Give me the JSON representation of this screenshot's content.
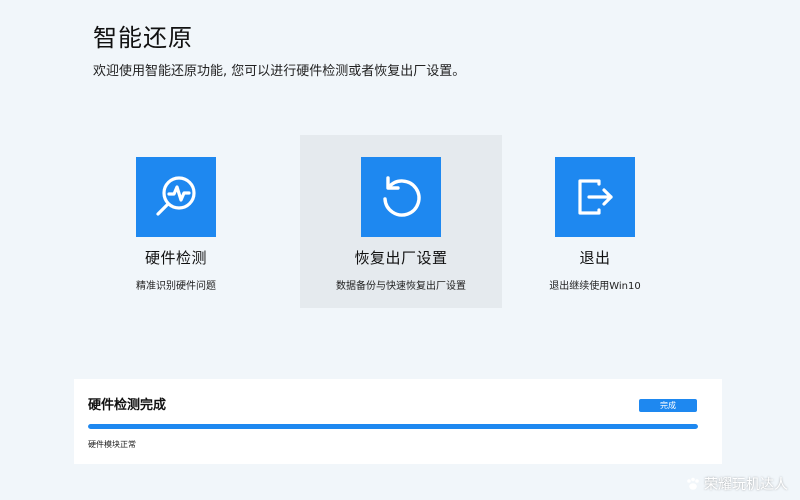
{
  "header": {
    "title": "智能还原",
    "subtitle": "欢迎使用智能还原功能, 您可以进行硬件检测或者恢复出厂设置。"
  },
  "options": [
    {
      "label": "硬件检测",
      "description": "精准识别硬件问题",
      "icon": "hardware-diagnostic-icon",
      "selected": false
    },
    {
      "label": "恢复出厂设置",
      "description": "数据备份与快速恢复出厂设置",
      "icon": "restore-icon",
      "selected": true
    },
    {
      "label": "退出",
      "description": "退出继续使用Win10",
      "icon": "exit-icon",
      "selected": false
    }
  ],
  "progress_panel": {
    "title": "硬件检测完成",
    "badge": "完成",
    "progress_percent": 100,
    "status": "硬件模块正常"
  },
  "watermark": {
    "text": "荣耀玩机达人"
  },
  "colors": {
    "accent": "#1e88f0",
    "background": "#f1f6fa",
    "selected_card": "#e5eaee",
    "panel": "#ffffff"
  }
}
